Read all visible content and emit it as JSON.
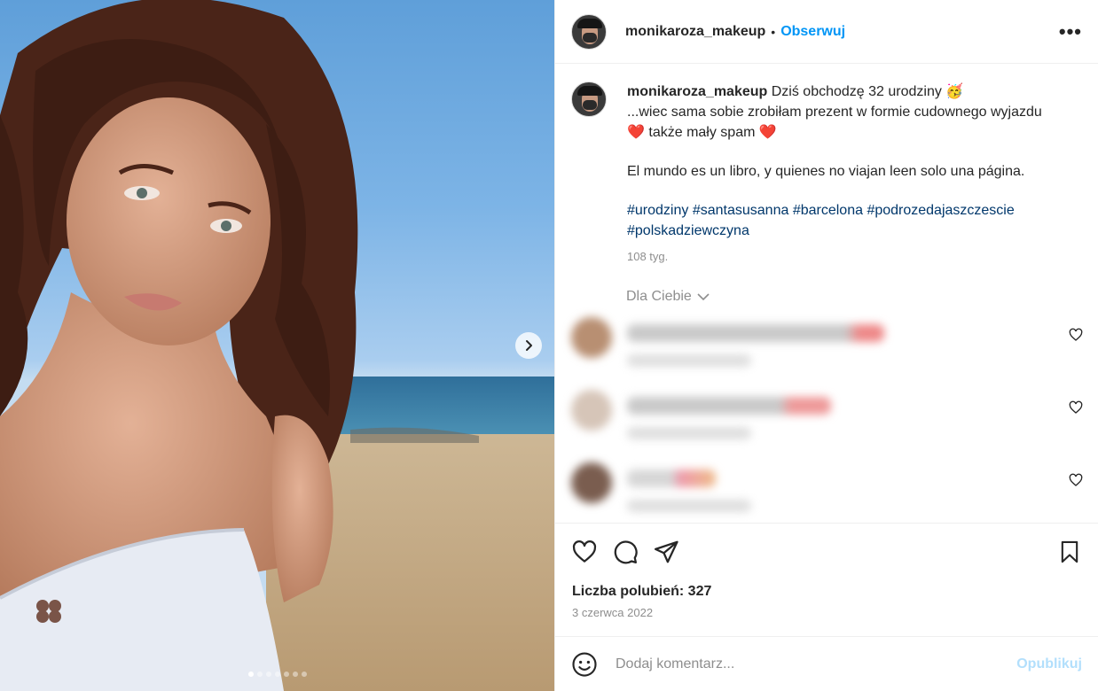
{
  "post": {
    "username": "monikaroza_makeup",
    "follow_label": "Obserwuj",
    "separator": "•",
    "more_label": "•••"
  },
  "caption": {
    "username": "monikaroza_makeup",
    "line1": "Dziś obchodzę 32 urodziny",
    "line1_emoji": "🥳",
    "line2": "...wiec sama sobie zrobiłam prezent w formie cudownego wyjazdu",
    "line2_emoji": "❤️",
    "line2_tail": "także mały spam",
    "line2_tail_emoji": "❤️",
    "quote": "El mundo es un libro, y quienes no viajan leen solo una página.",
    "hashtags": [
      "#urodziny",
      "#santasusanna",
      "#barcelona",
      "#podrozedajaszczescie",
      "#polskadziewczyna"
    ],
    "time": "108 tyg."
  },
  "for_you_label": "Dla Ciebie",
  "comments_count_visible": 3,
  "colors": {
    "accent": "#0095f6",
    "publish_disabled": "#b2dffc",
    "secondary_text": "#8e8e8e",
    "hashtag": "#00376b"
  },
  "likes": "Liczba polubień: 327",
  "date": "3 czerwca 2022",
  "comment_box": {
    "placeholder": "Dodaj komentarz...",
    "publish_label": "Opublikuj",
    "emoji_icon": "smiley-icon"
  },
  "carousel": {
    "slide_count": 7,
    "active_index": 1
  }
}
